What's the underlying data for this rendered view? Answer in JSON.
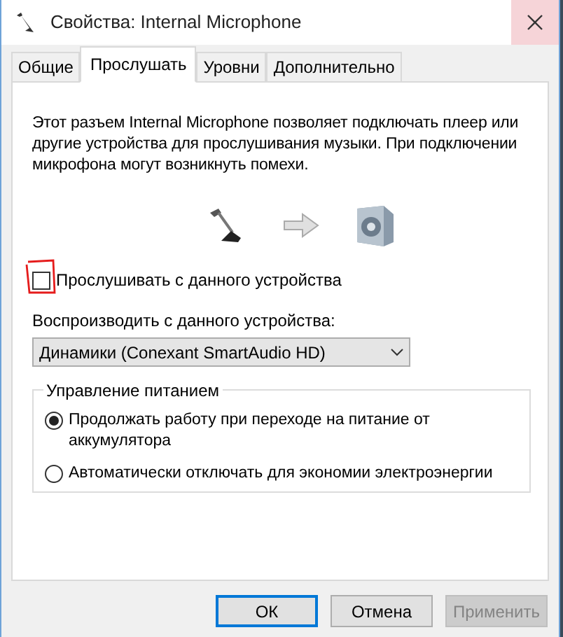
{
  "window": {
    "title": "Свойства: Internal Microphone"
  },
  "tabs": [
    {
      "label": "Общие",
      "selected": false
    },
    {
      "label": "Прослушать",
      "selected": true
    },
    {
      "label": "Уровни",
      "selected": false
    },
    {
      "label": "Дополнительно",
      "selected": false
    }
  ],
  "description": "Этот разъем Internal Microphone позволяет подключать плеер или другие устройства для прослушивания музыки. При подключении микрофона могут возникнуть помехи.",
  "listen_checkbox": {
    "label": "Прослушивать с данного устройства",
    "checked": false
  },
  "playback_device": {
    "label": "Воспроизводить с данного устройства:",
    "value": "Динамики (Conexant SmartAudio HD)"
  },
  "power_group": {
    "title": "Управление питанием",
    "options": [
      {
        "label": "Продолжать работу при переходе на питание от аккумулятора",
        "selected": true
      },
      {
        "label": "Автоматически отключать для экономии электроэнергии",
        "selected": false
      }
    ]
  },
  "buttons": [
    {
      "label": "ОК",
      "kind": "default",
      "disabled": false
    },
    {
      "label": "Отмена",
      "kind": "normal",
      "disabled": false
    },
    {
      "label": "Применить",
      "kind": "normal",
      "disabled": true
    }
  ]
}
